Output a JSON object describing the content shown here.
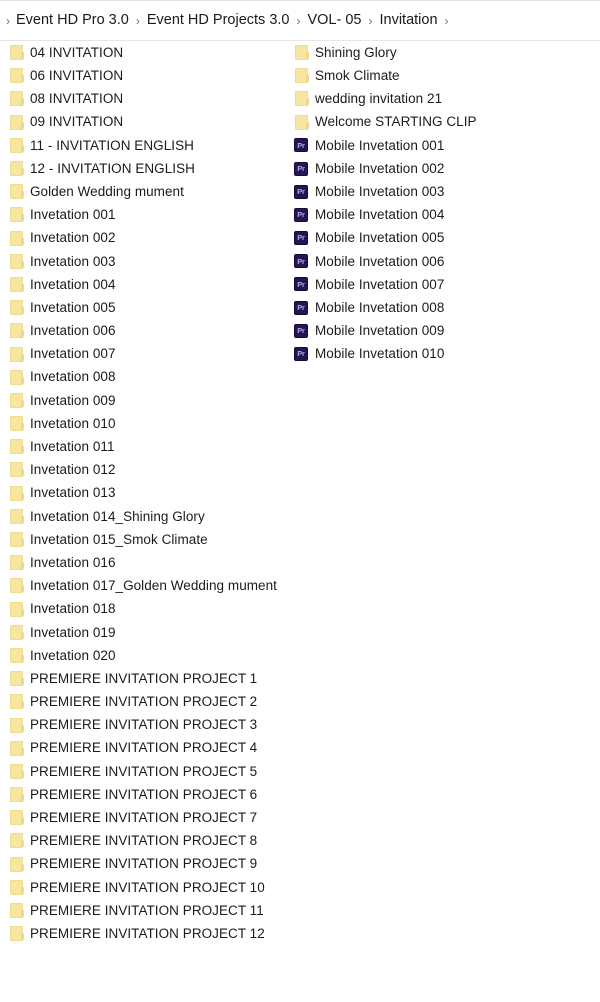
{
  "window": {
    "background_color": "#ffffff",
    "text_color": "#1b1b1b"
  },
  "breadcrumb": {
    "name": "address-bar-breadcrumb",
    "leading_separator": "›",
    "separator": "›",
    "items": [
      {
        "label": "Event HD Pro 3.0"
      },
      {
        "label": "Event HD Projects 3.0"
      },
      {
        "label": "VOL- 05"
      },
      {
        "label": "Invitation"
      }
    ]
  },
  "icons": {
    "folder": "folder-icon",
    "premiere": "premiere-pro-file-icon",
    "premiere_glyph": "Pr",
    "chevron": "chevron-right-icon"
  },
  "colors": {
    "folder_fill": "#f7e6a2",
    "folder_stroke": "#efdc90",
    "premiere_fill": "#241553",
    "premiere_glyph": "#b9a4e8",
    "separator_line": "#e6e6e6"
  },
  "file_list": {
    "columns": [
      {
        "name": "column-left",
        "items": [
          {
            "label": "04 INVITATION",
            "icon": "folder"
          },
          {
            "label": "06 INVITATION",
            "icon": "folder"
          },
          {
            "label": "08  INVITATION",
            "icon": "folder"
          },
          {
            "label": "09 INVITATION",
            "icon": "folder"
          },
          {
            "label": "11 -  INVITATION ENGLISH",
            "icon": "folder"
          },
          {
            "label": "12 - INVITATION ENGLISH",
            "icon": "folder"
          },
          {
            "label": "Golden Wedding mument",
            "icon": "folder"
          },
          {
            "label": "Invetation 001",
            "icon": "folder"
          },
          {
            "label": "Invetation 002",
            "icon": "folder"
          },
          {
            "label": "Invetation 003",
            "icon": "folder"
          },
          {
            "label": "Invetation 004",
            "icon": "folder"
          },
          {
            "label": "Invetation 005",
            "icon": "folder"
          },
          {
            "label": "Invetation 006",
            "icon": "folder"
          },
          {
            "label": "Invetation 007",
            "icon": "folder"
          },
          {
            "label": "Invetation 008",
            "icon": "folder"
          },
          {
            "label": "Invetation 009",
            "icon": "folder"
          },
          {
            "label": "Invetation 010",
            "icon": "folder"
          },
          {
            "label": "Invetation 011",
            "icon": "folder"
          },
          {
            "label": "Invetation 012",
            "icon": "folder"
          },
          {
            "label": "Invetation 013",
            "icon": "folder"
          },
          {
            "label": "Invetation 014_Shining Glory",
            "icon": "folder"
          },
          {
            "label": "Invetation 015_Smok Climate",
            "icon": "folder"
          },
          {
            "label": "Invetation 016",
            "icon": "folder"
          },
          {
            "label": "Invetation 017_Golden Wedding mument",
            "icon": "folder"
          },
          {
            "label": "Invetation 018",
            "icon": "folder"
          },
          {
            "label": "Invetation 019",
            "icon": "folder"
          },
          {
            "label": "Invetation 020",
            "icon": "folder"
          },
          {
            "label": "PREMIERE INVITATION PROJECT 1",
            "icon": "folder"
          },
          {
            "label": "PREMIERE INVITATION PROJECT 2",
            "icon": "folder"
          },
          {
            "label": "PREMIERE INVITATION PROJECT 3",
            "icon": "folder"
          },
          {
            "label": "PREMIERE INVITATION PROJECT 4",
            "icon": "folder"
          },
          {
            "label": "PREMIERE INVITATION PROJECT 5",
            "icon": "folder"
          },
          {
            "label": "PREMIERE INVITATION PROJECT 6",
            "icon": "folder"
          },
          {
            "label": "PREMIERE INVITATION PROJECT 7",
            "icon": "folder"
          },
          {
            "label": "PREMIERE INVITATION PROJECT 8",
            "icon": "folder"
          },
          {
            "label": "PREMIERE INVITATION PROJECT 9",
            "icon": "folder"
          },
          {
            "label": "PREMIERE INVITATION PROJECT 10",
            "icon": "folder"
          },
          {
            "label": "PREMIERE INVITATION PROJECT 11",
            "icon": "folder"
          },
          {
            "label": "PREMIERE INVITATION PROJECT 12",
            "icon": "folder"
          }
        ]
      },
      {
        "name": "column-right",
        "items": [
          {
            "label": "Shining Glory",
            "icon": "folder"
          },
          {
            "label": "Smok Climate",
            "icon": "folder"
          },
          {
            "label": "wedding invitation 21",
            "icon": "folder"
          },
          {
            "label": "Welcome STARTING CLIP",
            "icon": "folder"
          },
          {
            "label": "Mobile Invetation 001",
            "icon": "premiere"
          },
          {
            "label": "Mobile Invetation 002",
            "icon": "premiere"
          },
          {
            "label": "Mobile Invetation 003",
            "icon": "premiere"
          },
          {
            "label": "Mobile Invetation 004",
            "icon": "premiere"
          },
          {
            "label": "Mobile Invetation 005",
            "icon": "premiere"
          },
          {
            "label": "Mobile Invetation 006",
            "icon": "premiere"
          },
          {
            "label": "Mobile Invetation 007",
            "icon": "premiere"
          },
          {
            "label": "Mobile Invetation 008",
            "icon": "premiere"
          },
          {
            "label": "Mobile Invetation 009",
            "icon": "premiere"
          },
          {
            "label": "Mobile Invetation 010",
            "icon": "premiere"
          }
        ]
      }
    ]
  }
}
